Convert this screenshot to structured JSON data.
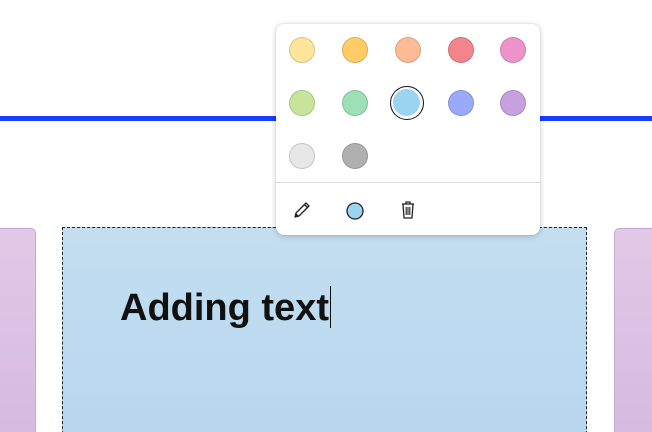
{
  "colors": {
    "connector": "#1a3cff",
    "selected_note": "#b8d8ef",
    "side_notes": "#dcc3e4"
  },
  "palette": {
    "swatches": [
      {
        "name": "light-yellow",
        "color": "#ffe599",
        "selected": false
      },
      {
        "name": "yellow",
        "color": "#ffcc66",
        "selected": false
      },
      {
        "name": "light-orange",
        "color": "#fdbc94",
        "selected": false
      },
      {
        "name": "red",
        "color": "#f2848c",
        "selected": false
      },
      {
        "name": "pink",
        "color": "#ee93c9",
        "selected": false
      },
      {
        "name": "light-green",
        "color": "#c7e59a",
        "selected": false
      },
      {
        "name": "green",
        "color": "#9ee0b5",
        "selected": false
      },
      {
        "name": "light-blue",
        "color": "#9bd4f0",
        "selected": true
      },
      {
        "name": "blue",
        "color": "#9aaaf9",
        "selected": false
      },
      {
        "name": "violet",
        "color": "#c6a0df",
        "selected": false
      },
      {
        "name": "light-gray",
        "color": "#e7e7e7",
        "selected": false
      },
      {
        "name": "gray",
        "color": "#b0b0b0",
        "selected": false
      }
    ],
    "tools": [
      {
        "name": "pencil-icon"
      },
      {
        "name": "color-circle-icon",
        "color": "#9bd4f0"
      },
      {
        "name": "trash-icon"
      }
    ]
  },
  "note": {
    "text": "Adding text"
  }
}
